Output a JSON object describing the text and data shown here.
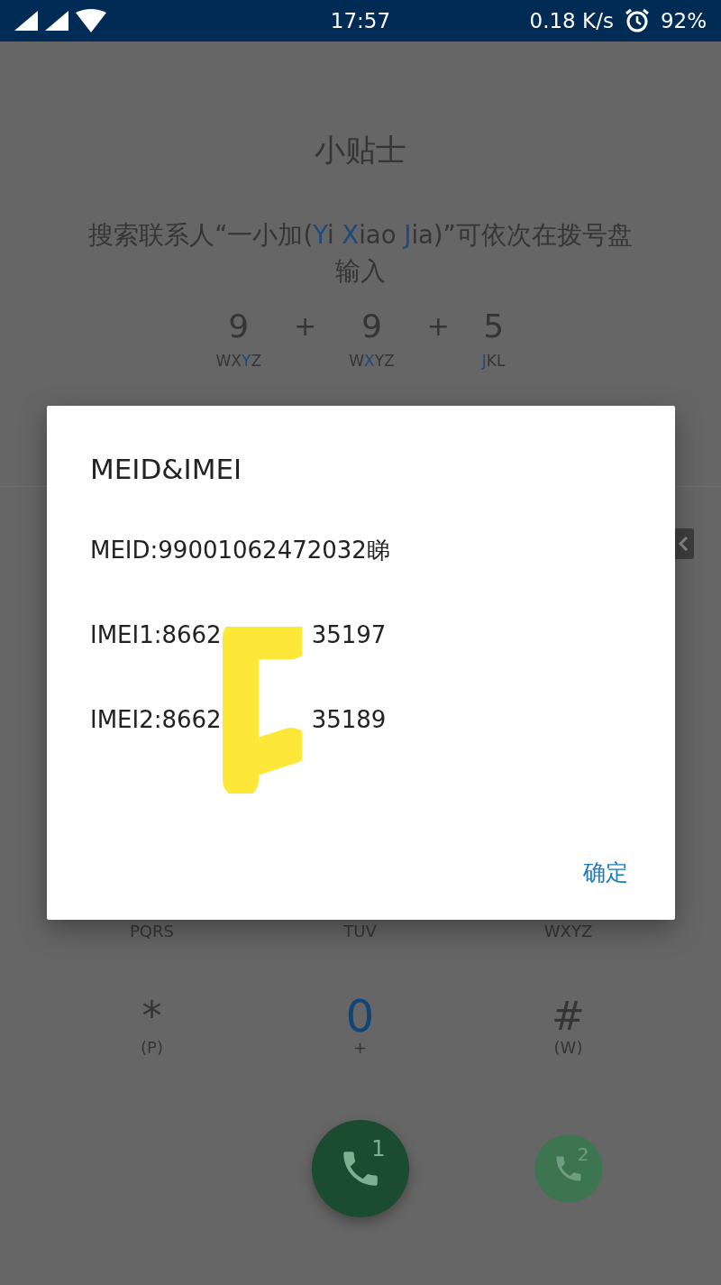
{
  "status_bar": {
    "time": "17:57",
    "net_speed": "0.18 K/s",
    "battery": "92%"
  },
  "tip": {
    "title": "小贴士",
    "sentence": [
      {
        "text": "搜索联系人“一小加(",
        "highlight": false
      },
      {
        "text": "Y",
        "highlight": true
      },
      {
        "text": "i ",
        "highlight": false
      },
      {
        "text": "X",
        "highlight": true
      },
      {
        "text": "iao ",
        "highlight": false
      },
      {
        "text": "J",
        "highlight": true
      },
      {
        "text": "ia)”可依次在拨号盘输入",
        "highlight": false
      }
    ],
    "sequence": [
      {
        "kind": "key",
        "digit": "9",
        "letters": [
          {
            "text": "WX",
            "highlight": false
          },
          {
            "text": "Y",
            "highlight": true
          },
          {
            "text": "Z",
            "highlight": false
          }
        ]
      },
      {
        "kind": "plus",
        "symbol": "+"
      },
      {
        "kind": "key",
        "digit": "9",
        "letters": [
          {
            "text": "W",
            "highlight": false
          },
          {
            "text": "X",
            "highlight": true
          },
          {
            "text": "YZ",
            "highlight": false
          }
        ]
      },
      {
        "kind": "plus",
        "symbol": "+"
      },
      {
        "kind": "key",
        "digit": "5",
        "letters": [
          {
            "text": "J",
            "highlight": true
          },
          {
            "text": "KL",
            "highlight": false
          }
        ]
      }
    ]
  },
  "keypad": {
    "rows": [
      [
        {
          "kind": "letters",
          "sub": "PQRS"
        },
        {
          "kind": "letters",
          "sub": "TUV"
        },
        {
          "kind": "letters",
          "sub": "WXYZ"
        }
      ],
      [
        {
          "kind": "symbol",
          "main": "*",
          "sub": "(P)"
        },
        {
          "kind": "digit",
          "main": "0",
          "sub": "+"
        },
        {
          "kind": "symbol",
          "main": "#",
          "sub": "(W)"
        }
      ]
    ],
    "calls": [
      {
        "sim": "1",
        "primary": true
      },
      {
        "sim": "2",
        "primary": false
      }
    ]
  },
  "dialog": {
    "title": "MEID&IMEI",
    "lines": [
      {
        "kind": "plain",
        "text": "MEID:99001062472032睇"
      },
      {
        "kind": "redacted",
        "before": "IMEI1:8662",
        "after": "35197"
      },
      {
        "kind": "redacted",
        "before": "IMEI2:8662",
        "after": "35189"
      }
    ],
    "button": "确定"
  }
}
